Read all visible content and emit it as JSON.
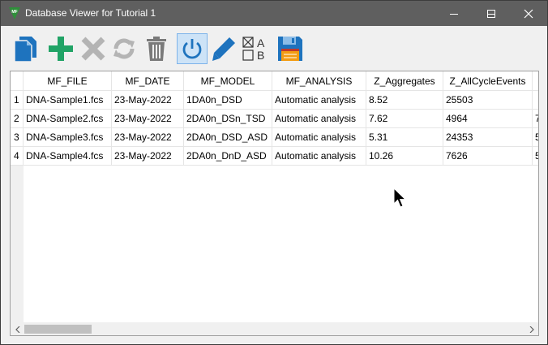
{
  "window": {
    "title": "Database Viewer for Tutorial 1",
    "app_icon": "mf-logo-icon",
    "controls": [
      "minimize-icon",
      "maximize-icon",
      "close-icon"
    ]
  },
  "toolbar": {
    "buttons": [
      {
        "name": "copy-button",
        "icon": "copy-documents-icon",
        "enabled": true
      },
      {
        "name": "add-button",
        "icon": "plus-icon",
        "enabled": true
      },
      {
        "name": "delete-button",
        "icon": "x-icon",
        "enabled": false
      },
      {
        "name": "refresh-button",
        "icon": "refresh-icon",
        "enabled": false
      },
      {
        "name": "trash-button",
        "icon": "trash-icon",
        "enabled": true
      },
      {
        "name": "power-button",
        "icon": "power-icon",
        "enabled": true,
        "active": true
      },
      {
        "name": "edit-button",
        "icon": "pencil-icon",
        "enabled": true
      },
      {
        "name": "checkbox-ab-button",
        "icon": "checkbox-ab-icon",
        "enabled": true,
        "labels": [
          "A",
          "B"
        ]
      },
      {
        "name": "save-button",
        "icon": "floppy-disk-icon",
        "enabled": true
      }
    ]
  },
  "table": {
    "columns": [
      "MF_FILE",
      "MF_DATE",
      "MF_MODEL",
      "MF_ANALYSIS",
      "Z_Aggregates",
      "Z_AllCycleEvents"
    ],
    "rows": [
      {
        "num": "1",
        "cells": [
          "DNA-Sample1.fcs",
          "23-May-2022",
          "1DA0n_DSD",
          "Automatic analysis",
          "8.52",
          "25503",
          ""
        ]
      },
      {
        "num": "2",
        "cells": [
          "DNA-Sample2.fcs",
          "23-May-2022",
          "2DA0n_DSn_TSD",
          "Automatic analysis",
          "7.62",
          "4964",
          "7"
        ]
      },
      {
        "num": "3",
        "cells": [
          "DNA-Sample3.fcs",
          "23-May-2022",
          "2DA0n_DSD_ASD",
          "Automatic analysis",
          "5.31",
          "24353",
          "5"
        ]
      },
      {
        "num": "4",
        "cells": [
          "DNA-Sample4.fcs",
          "23-May-2022",
          "2DA0n_DnD_ASD",
          "Automatic analysis",
          "10.26",
          "7626",
          "5"
        ]
      }
    ]
  },
  "colors": {
    "titlebar": "#5f5f5f",
    "accent_blue": "#1e73be",
    "add_green": "#21a366",
    "disabled_gray": "#b4b4b4"
  }
}
